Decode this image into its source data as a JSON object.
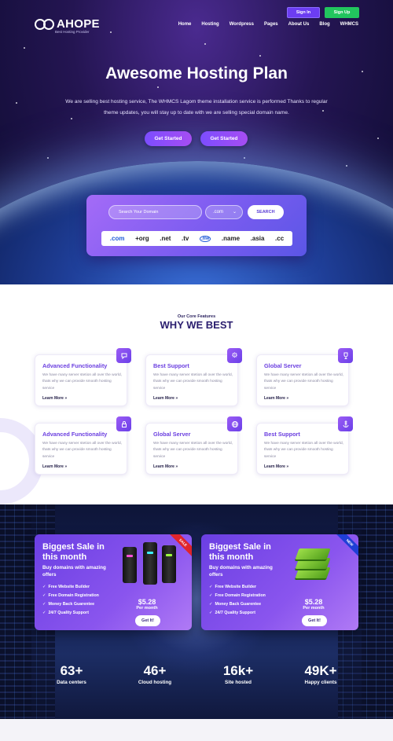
{
  "header": {
    "logo_name": "AHOPE",
    "logo_tagline": "Best Hosting Provider",
    "signin_label": "Sign In",
    "signup_label": "Sign Up",
    "nav": [
      "Home",
      "Hosting",
      "Wordpress",
      "Pages",
      "About Us",
      "Blog",
      "WHMCS"
    ]
  },
  "hero": {
    "title": "Awesome Hosting Plan",
    "subtitle": "We are selling best hosting service, The WHMCS Lagom theme installation service is performed Thanks to regular theme updates, you will stay up to date with we are selling special domain name.",
    "cta_primary": "Get Started",
    "cta_secondary": "Get Started"
  },
  "domain_search": {
    "placeholder": "Search Your Domain",
    "tld_selected": ".com",
    "button_label": "SEARCH",
    "tlds": [
      ".com",
      "+org",
      ".net",
      ".tv",
      ".me",
      ".name",
      ".asia",
      ".cc"
    ]
  },
  "features": {
    "eyebrow": "Our Core Features",
    "title": "WHY WE BEST",
    "cards": [
      {
        "title": "Advanced Functionality",
        "desc": "We have many server stetion all over the world, thats why we can provide smooth hosting service",
        "more": "Learn More »",
        "icon": "chat-bubble-icon"
      },
      {
        "title": "Best Support",
        "desc": "We have many server stetion all over the world, thats why we can provide smooth hosting service",
        "more": "Learn More »",
        "icon": "gear-icon"
      },
      {
        "title": "Global Server",
        "desc": "We have many server stetion all over the world, thats why we can provide smooth hosting service",
        "more": "Learn More »",
        "icon": "trophy-icon"
      },
      {
        "title": "Advanced Functionality",
        "desc": "We have many server stetion all over the world, thats why we can provide smooth hosting service",
        "more": "Learn More »",
        "icon": "lock-icon"
      },
      {
        "title": "Global Server",
        "desc": "We have many server stetion all over the world, thats why we can provide smooth hosting service",
        "more": "Learn More »",
        "icon": "globe-icon"
      },
      {
        "title": "Best Support",
        "desc": "We have many server stetion all over the world, thats why we can provide smooth hosting service",
        "more": "Learn More »",
        "icon": "anchor-icon"
      }
    ]
  },
  "offers": [
    {
      "title": "Biggest Sale in this month",
      "subtitle": "Buy domains with amazing offers",
      "features": [
        "Free Website Builder",
        "Free Domain Registration",
        "Money Back Guarentee",
        "24/7 Quality Support"
      ],
      "price": "$5.28",
      "per": "Per month",
      "button": "Get It!",
      "ribbon": "SALE",
      "ribbon_color": "#e0252b"
    },
    {
      "title": "Biggest Sale in this month",
      "subtitle": "Buy domains with amazing offers",
      "features": [
        "Free Website Builder",
        "Free Domain Registration",
        "Money Back Guarentee",
        "24/7 Quality Support"
      ],
      "price": "$5.28",
      "per": "Per month",
      "button": "Get It!",
      "ribbon": "NEW",
      "ribbon_color": "#1f3fd6"
    }
  ],
  "stats": [
    {
      "num": "63+",
      "label": "Data centers"
    },
    {
      "num": "46+",
      "label": "Cloud hosting"
    },
    {
      "num": "16k+",
      "label": "Site hosted"
    },
    {
      "num": "49K+",
      "label": "Happy clients"
    }
  ]
}
